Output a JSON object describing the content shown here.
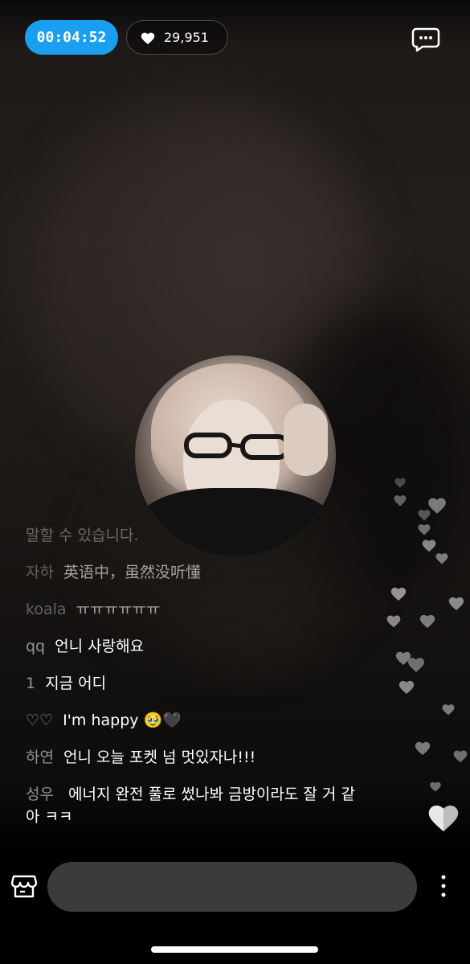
{
  "header": {
    "timer": "00:04:52",
    "like_count": "29,951"
  },
  "chat": {
    "partial_line": "",
    "messages": [
      {
        "user": "",
        "text": "말할 수 있습니다."
      },
      {
        "user": "자하",
        "text": "英语中，虽然没听懂"
      },
      {
        "user": "koala",
        "text": "ㅠㅠㅠㅠㅠㅠ"
      },
      {
        "user": "qq",
        "text": "언니 사랑해요"
      },
      {
        "user": "1",
        "text": "지금 어디"
      },
      {
        "user": "♡♡",
        "text": "I'm happy 🥹🖤"
      },
      {
        "user": "하연",
        "text": "언니 오늘 포켓 넘 멋있자나!!!"
      },
      {
        "user": "성우",
        "text": "에너지 완전 풀로 썼나봐 금방이라도 잘 거 같아 ㅋㅋ"
      }
    ]
  },
  "input": {
    "placeholder": ""
  },
  "icons": {
    "likes": "heart-icon",
    "chat": "chat-bubble-icon",
    "store": "store-icon",
    "more": "more-vertical-icon",
    "reaction": "heart-reaction-icon"
  },
  "colors": {
    "timer_bg": "#1a9ef0",
    "input_bg": "#3b3b3d"
  }
}
